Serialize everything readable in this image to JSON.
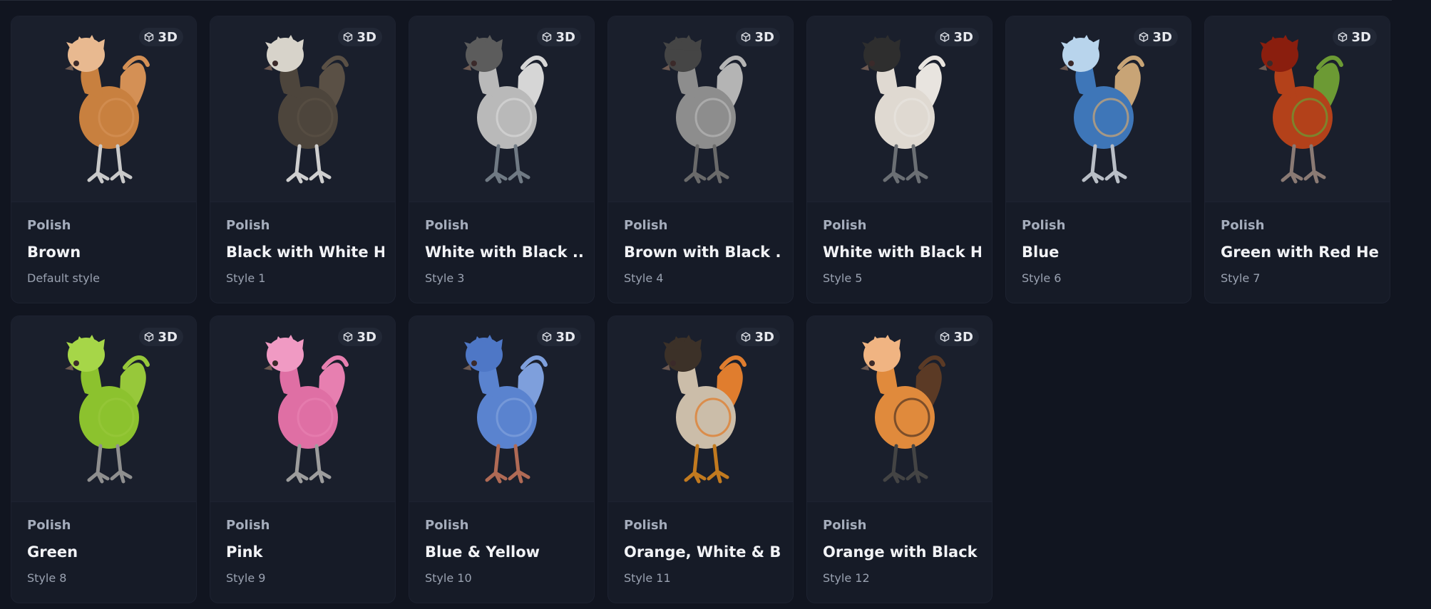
{
  "badge_label": "3D",
  "cards": [
    {
      "breed": "Polish",
      "name": "Brown",
      "style": "Default style",
      "colors": {
        "body": "#c8803f",
        "crest": "#e8b990",
        "tail": "#d49055",
        "legs": "#c9c9c9"
      }
    },
    {
      "breed": "Polish",
      "name": "Black with White H...",
      "style": "Style 1",
      "colors": {
        "body": "#4d453c",
        "crest": "#d7d3ca",
        "tail": "#5a5045",
        "legs": "#cfcfcf"
      }
    },
    {
      "breed": "Polish",
      "name": "White with Black ...",
      "style": "Style 3",
      "colors": {
        "body": "#b9b9b9",
        "crest": "#5c5c5c",
        "tail": "#d6d6d6",
        "legs": "#707a84"
      }
    },
    {
      "breed": "Polish",
      "name": "Brown with Black ...",
      "style": "Style 4",
      "colors": {
        "body": "#8d8d8d",
        "crest": "#454545",
        "tail": "#b4b4b4",
        "legs": "#6a6a6a"
      }
    },
    {
      "breed": "Polish",
      "name": "White with Black H...",
      "style": "Style 5",
      "colors": {
        "body": "#dfd9d1",
        "crest": "#2e2e2e",
        "tail": "#e8e4df",
        "legs": "#6b6f74"
      }
    },
    {
      "breed": "Polish",
      "name": "Blue",
      "style": "Style 6",
      "colors": {
        "body": "#3e76b8",
        "crest": "#b8d4ec",
        "tail": "#c8a476",
        "legs": "#b9bec6"
      }
    },
    {
      "breed": "Polish",
      "name": "Green with Red Head",
      "style": "Style 7",
      "colors": {
        "body": "#b3411a",
        "crest": "#8a1e0e",
        "tail": "#6c9a34",
        "legs": "#8a7a74"
      }
    },
    {
      "breed": "Polish",
      "name": "Green",
      "style": "Style 8",
      "colors": {
        "body": "#8cc22e",
        "crest": "#a6d648",
        "tail": "#97c83a",
        "legs": "#8f8f8f"
      }
    },
    {
      "breed": "Polish",
      "name": "Pink",
      "style": "Style 9",
      "colors": {
        "body": "#df6fa4",
        "crest": "#f09ac3",
        "tail": "#e77fb0",
        "legs": "#9d9d9d"
      }
    },
    {
      "breed": "Polish",
      "name": "Blue & Yellow",
      "style": "Style 10",
      "colors": {
        "body": "#5a83cf",
        "crest": "#4e77c6",
        "tail": "#7e9fdc",
        "legs": "#b06a55"
      }
    },
    {
      "breed": "Polish",
      "name": "Orange, White & Bl...",
      "style": "Style 11",
      "colors": {
        "body": "#cbbda9",
        "crest": "#3c3128",
        "tail": "#e07d2e",
        "legs": "#c27a1f"
      }
    },
    {
      "breed": "Polish",
      "name": "Orange with Black ...",
      "style": "Style 12",
      "colors": {
        "body": "#e08a3c",
        "crest": "#f0b482",
        "tail": "#5b3a25",
        "legs": "#444"
      }
    }
  ]
}
